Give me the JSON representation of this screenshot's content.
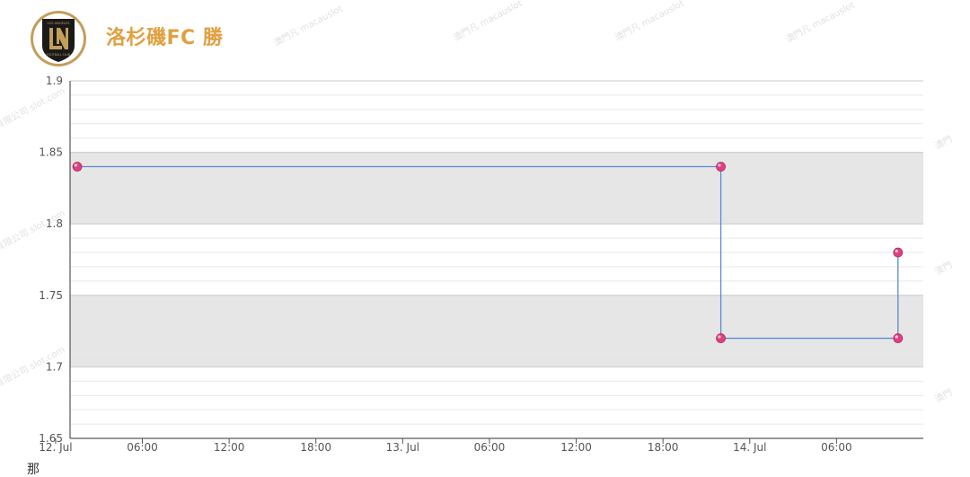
{
  "header": {
    "title": "洛杉磯FC 勝",
    "logo_alt": "LAFC",
    "logo_text_top": "LOS ANGELES",
    "logo_text_bottom": "FOOTBALL CLUB"
  },
  "footer": {
    "partial_text": "那"
  },
  "colors": {
    "title": "#e0a040",
    "line": "#5b8ad6",
    "marker": "#e0407f",
    "band": "#e6e6e6"
  },
  "chart_data": {
    "type": "line",
    "step": true,
    "title": "洛杉磯FC 勝",
    "ylim": [
      1.65,
      1.9
    ],
    "yticks": [
      1.65,
      1.7,
      1.75,
      1.8,
      1.85,
      1.9
    ],
    "ytick_labels": [
      "1.65",
      "1.7",
      "1.75",
      "1.8",
      "1.85",
      "1.9"
    ],
    "xlim": [
      "12 Jul 01:00",
      "14 Jul 12:00"
    ],
    "xtick_labels": [
      "12. Jul",
      "06:00",
      "12:00",
      "18:00",
      "13. Jul",
      "06:00",
      "12:00",
      "18:00",
      "14. Jul",
      "06:00"
    ],
    "alternating_bands": true,
    "series": [
      {
        "x": [
          "12 Jul 01:30",
          "13 Jul 22:00",
          "13 Jul 22:00",
          "14 Jul 10:15",
          "14 Jul 10:15"
        ],
        "y": [
          1.84,
          1.84,
          1.72,
          1.72,
          1.78
        ]
      }
    ]
  }
}
